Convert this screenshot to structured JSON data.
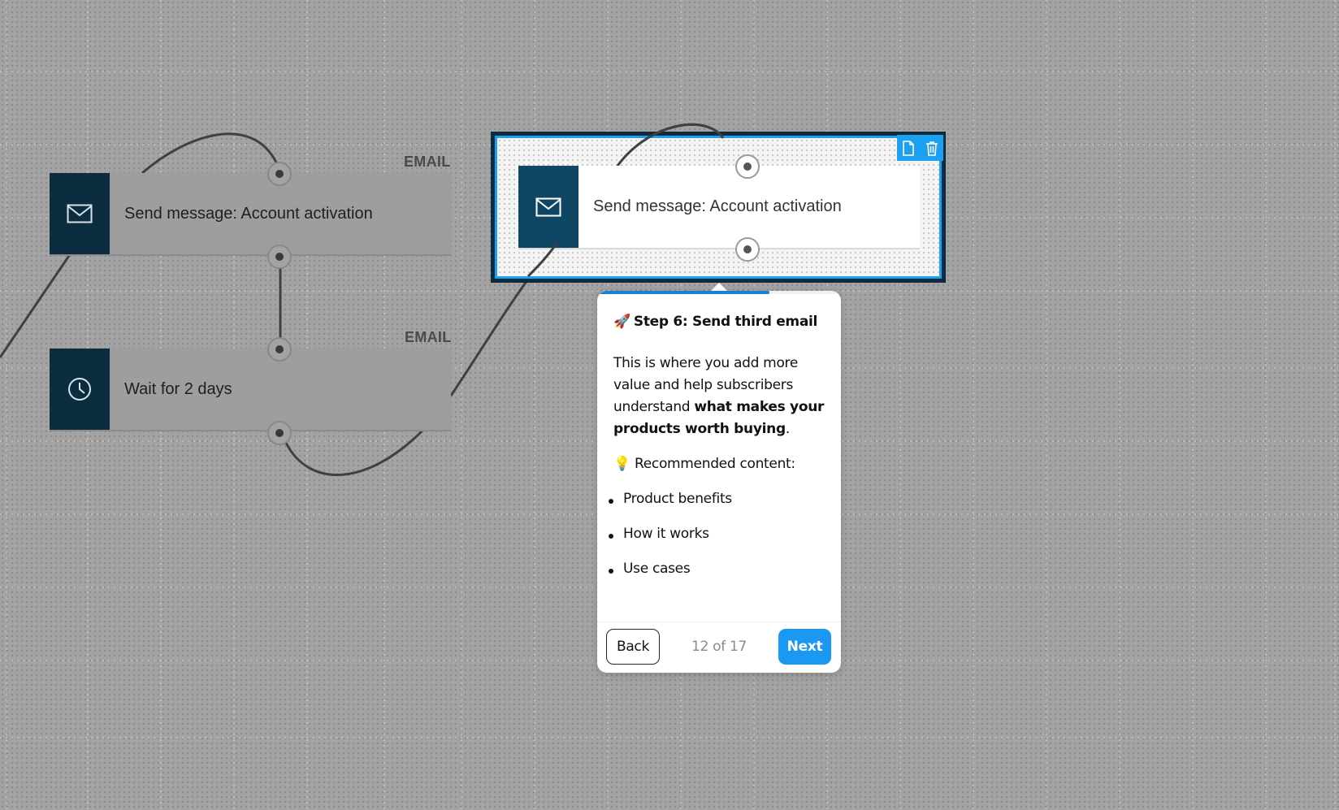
{
  "canvas": {
    "background": "#a3a3a3",
    "accent": "#1ea0f0",
    "node_icon_color": "#0c2d40"
  },
  "nodes": [
    {
      "id": "send-1",
      "channel_label": "EMAIL",
      "label": "Send message: Account activation",
      "icon": "envelope-icon"
    },
    {
      "id": "wait-1",
      "channel_label": "EMAIL",
      "label": "Wait for 2 days",
      "icon": "clock-icon"
    }
  ],
  "selected_node": {
    "label": "Send message: Account activation",
    "icon": "envelope-icon",
    "toolbar": {
      "duplicate_icon": "document-icon",
      "delete_icon": "trash-icon"
    }
  },
  "tour": {
    "progress_fraction": 0.706,
    "title_emoji": "🚀",
    "title": "Step 6: Send third email",
    "body_intro": "This is where you add more value and help subscribers understand ",
    "body_bold": "what makes your products worth buying",
    "body_end": ".",
    "recommended_emoji": "💡",
    "recommended_label": "Recommended content:",
    "items": [
      "Product benefits",
      "How it works",
      "Use cases"
    ],
    "back_label": "Back",
    "counter": "12 of 17",
    "next_label": "Next",
    "next_color": "#1a98f2"
  }
}
